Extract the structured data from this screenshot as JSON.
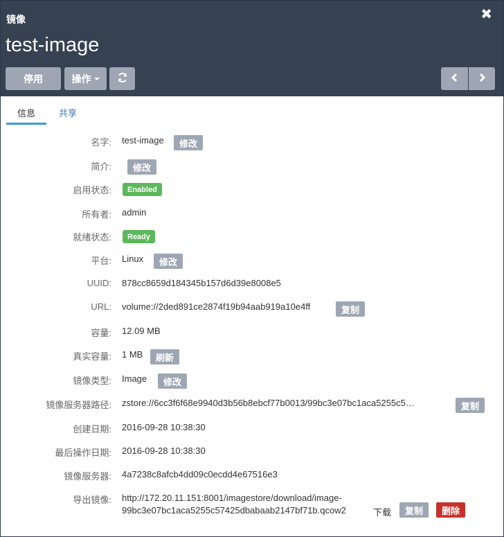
{
  "header": {
    "kind": "镜像",
    "title": "test-image",
    "close": "✖",
    "buttons": {
      "disable": "停用",
      "actions": "操作",
      "refresh": "⟳",
      "prev": "‹",
      "next": "›"
    }
  },
  "tabs": [
    {
      "label": "信息",
      "active": true
    },
    {
      "label": "共享",
      "active": false
    }
  ],
  "fields": {
    "name": {
      "label": "名字:",
      "value": "test-image",
      "action": "修改"
    },
    "description": {
      "label": "简介:",
      "value": "",
      "action": "修改"
    },
    "enable_state": {
      "label": "启用状态:",
      "value": "Enabled"
    },
    "owner": {
      "label": "所有者:",
      "value": "admin"
    },
    "ready_state": {
      "label": "就绪状态:",
      "value": "Ready"
    },
    "platform": {
      "label": "平台:",
      "value": "Linux",
      "action": "修改"
    },
    "uuid": {
      "label": "UUID:",
      "value": "878cc8659d184345b157d6d39e8008e5"
    },
    "url": {
      "label": "URL:",
      "value": "volume://2ded891ce2874f19b94aab919a10e4ff",
      "action": "复制"
    },
    "size": {
      "label": "容量:",
      "value": "12.09 MB"
    },
    "actual_size": {
      "label": "真实容量:",
      "value": "1 MB",
      "action": "刷新"
    },
    "image_type": {
      "label": "镜像类型:",
      "value": "Image",
      "action": "修改"
    },
    "backup_path": {
      "label": "镜像服务器路径:",
      "value": "zstore://6cc3f6f68e9940d3b56b8ebcf77b0013/99bc3e07bc1aca5255c5…",
      "action": "复制"
    },
    "created": {
      "label": "创建日期:",
      "value": "2016-09-28 10:38:30"
    },
    "last_op": {
      "label": "最后操作日期:",
      "value": "2016-09-28 10:38:30"
    },
    "backup_server": {
      "label": "镜像服务器:",
      "value": "4a7238c8afcb4dd09c0ecdd4e67516e3"
    },
    "export": {
      "label": "导出镜像:",
      "line1": "http://172.20.11.151:8001/imagestore/download/image-",
      "line2": "99bc3e07bc1aca5255c57425dbabaab2147bf71b.qcow2",
      "download": "下载",
      "copy": "复制",
      "delete": "删除"
    }
  },
  "colors": {
    "header_bg": "#364152",
    "button_gray": "#9da6b2",
    "badge_green": "#5cb85c",
    "danger_red": "#c9302c",
    "link_blue": "#2c6fb0",
    "tab_underline": "#3a9ad9"
  }
}
